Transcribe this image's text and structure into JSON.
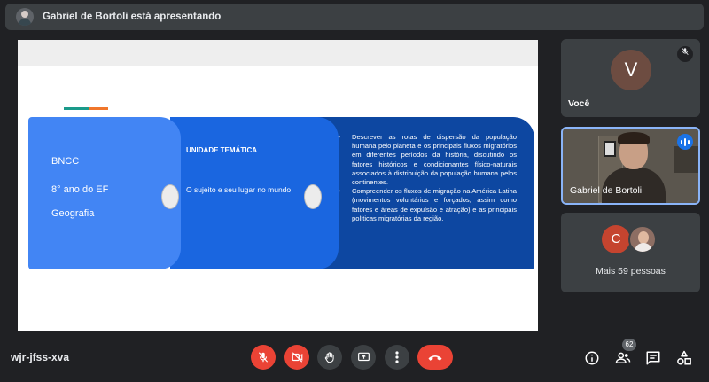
{
  "presenter_banner": {
    "text": "Gabriel de Bortoli está apresentando"
  },
  "slide": {
    "panel1": {
      "line1": "BNCC",
      "line2": "8° ano do EF",
      "line3": "Geografia"
    },
    "panel2": {
      "title": "UNIDADE TEMÁTICA",
      "body": "O sujeito e seu lugar no mundo"
    },
    "panel3": {
      "bullets": [
        "Descrever as rotas de dispersão da população humana pelo planeta e os principais fluxos migratórios em diferentes períodos da história, discutindo os fatores históricos e condicionantes físico-naturais associados à distribuição da população humana pelos continentes.",
        "Compreender os fluxos de migração na América Latina (movimentos voluntários e forçados, assim como fatores e áreas de expulsão e atração) e as principais políticas migratórias da região."
      ]
    }
  },
  "participants": {
    "you": {
      "initial": "V",
      "name": "Você",
      "icon": "mic-off-icon"
    },
    "presenter": {
      "name": "Gabriel de Bortoli",
      "icon": "speaking-icon"
    },
    "others": {
      "initial": "C",
      "label": "Mais 59 pessoas"
    }
  },
  "bottom_bar": {
    "meeting_code": "wjr-jfss-xva",
    "people_count": "62",
    "controls": [
      "mic-off-icon",
      "camera-off-icon",
      "raise-hand-icon",
      "present-screen-icon",
      "more-options-icon",
      "end-call-icon"
    ],
    "right_icons": [
      "info-icon",
      "people-icon",
      "chat-icon",
      "activities-icon"
    ]
  },
  "colors": {
    "background": "#202124",
    "tile": "#3c4043",
    "danger": "#ea4335",
    "accent": "#1a73e8",
    "panel1": "#4285f4",
    "panel2": "#1a66e0",
    "panel3": "#0d47a1"
  }
}
